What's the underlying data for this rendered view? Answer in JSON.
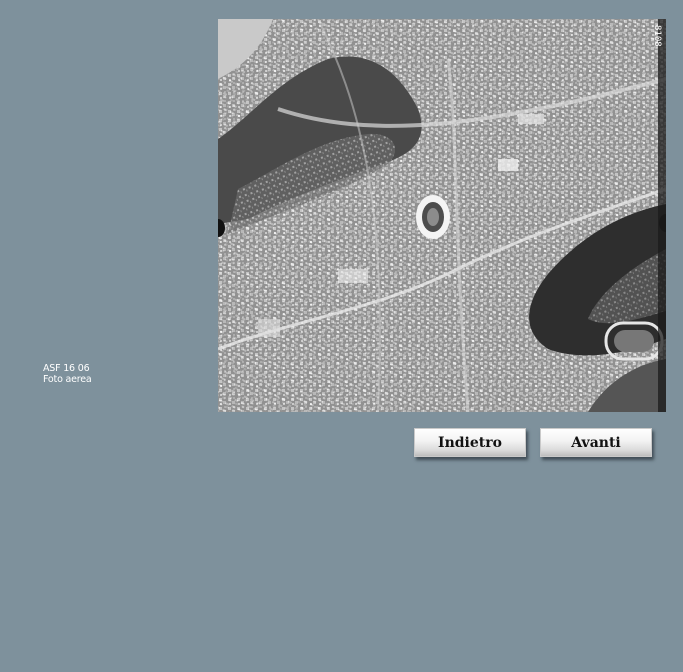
{
  "caption": {
    "line1": "ASF 16 06",
    "line2": "Foto aerea"
  },
  "photo": {
    "frame_label": "8108"
  },
  "nav": {
    "back_label": "Indietro",
    "next_label": "Avanti"
  }
}
